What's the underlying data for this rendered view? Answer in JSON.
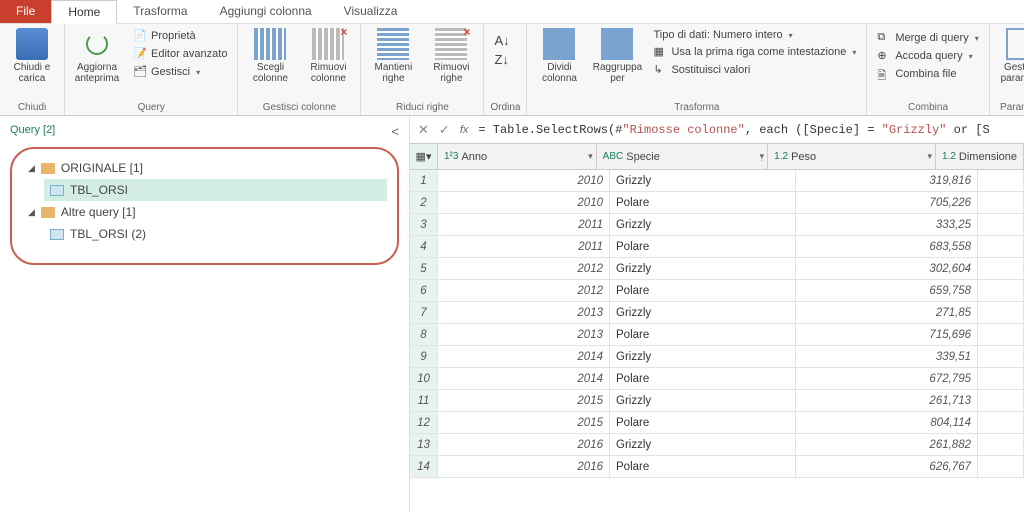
{
  "tabs": {
    "file": "File",
    "home": "Home",
    "trasforma": "Trasforma",
    "aggiungi": "Aggiungi colonna",
    "visualizza": "Visualizza"
  },
  "ribbon": {
    "chiudi": {
      "label": "Chiudi e\ncarica",
      "group": "Chiudi"
    },
    "aggiorna": {
      "label": "Aggiorna\nanteprima"
    },
    "query": {
      "proprieta": "Proprietà",
      "editor": "Editor avanzato",
      "gestisci": "Gestisci",
      "group": "Query"
    },
    "colonne": {
      "scegli": "Scegli\ncolonne",
      "rimuovi": "Rimuovi\ncolonne",
      "group": "Gestisci colonne"
    },
    "righe": {
      "mantieni": "Mantieni\nrighe",
      "rimuovi": "Rimuovi\nrighe",
      "group": "Riduci righe"
    },
    "ordina": {
      "group": "Ordina"
    },
    "trasforma": {
      "dividi": "Dividi\ncolonna",
      "raggruppa": "Raggruppa\nper",
      "tipo": "Tipo di dati: Numero intero",
      "prima": "Usa la prima riga come intestazione",
      "sost": "Sostituisci valori",
      "group": "Trasforma"
    },
    "combina": {
      "merge": "Merge di query",
      "accoda": "Accoda query",
      "file": "Combina file",
      "group": "Combina"
    },
    "parametri": {
      "gestisci": "Gestisci\nparametri",
      "group": "Parametri"
    }
  },
  "sidebar": {
    "title": "Query [2]",
    "folders": [
      {
        "name": "ORIGINALE [1]",
        "items": [
          "TBL_ORSI"
        ]
      },
      {
        "name": "Altre query [1]",
        "items": [
          "TBL_ORSI (2)"
        ]
      }
    ]
  },
  "formula": {
    "fx": "fx",
    "text": "= Table.SelectRows(#\"Rimosse colonne\", each ([Specie] = \"Grizzly\" or [S"
  },
  "columns": [
    {
      "type": "1²3",
      "name": "Anno"
    },
    {
      "type": "ABC",
      "name": "Specie",
      "filtered": true
    },
    {
      "type": "1.2",
      "name": "Peso"
    },
    {
      "type": "1.2",
      "name": "Dimensione"
    }
  ],
  "rows": [
    {
      "n": 1,
      "anno": "2010",
      "specie": "Grizzly",
      "peso": "319,816"
    },
    {
      "n": 2,
      "anno": "2010",
      "specie": "Polare",
      "peso": "705,226"
    },
    {
      "n": 3,
      "anno": "2011",
      "specie": "Grizzly",
      "peso": "333,25"
    },
    {
      "n": 4,
      "anno": "2011",
      "specie": "Polare",
      "peso": "683,558"
    },
    {
      "n": 5,
      "anno": "2012",
      "specie": "Grizzly",
      "peso": "302,604"
    },
    {
      "n": 6,
      "anno": "2012",
      "specie": "Polare",
      "peso": "659,758"
    },
    {
      "n": 7,
      "anno": "2013",
      "specie": "Grizzly",
      "peso": "271,85"
    },
    {
      "n": 8,
      "anno": "2013",
      "specie": "Polare",
      "peso": "715,696"
    },
    {
      "n": 9,
      "anno": "2014",
      "specie": "Grizzly",
      "peso": "339,51"
    },
    {
      "n": 10,
      "anno": "2014",
      "specie": "Polare",
      "peso": "672,795"
    },
    {
      "n": 11,
      "anno": "2015",
      "specie": "Grizzly",
      "peso": "261,713"
    },
    {
      "n": 12,
      "anno": "2015",
      "specie": "Polare",
      "peso": "804,114"
    },
    {
      "n": 13,
      "anno": "2016",
      "specie": "Grizzly",
      "peso": "261,882"
    },
    {
      "n": 14,
      "anno": "2016",
      "specie": "Polare",
      "peso": "626,767"
    }
  ]
}
